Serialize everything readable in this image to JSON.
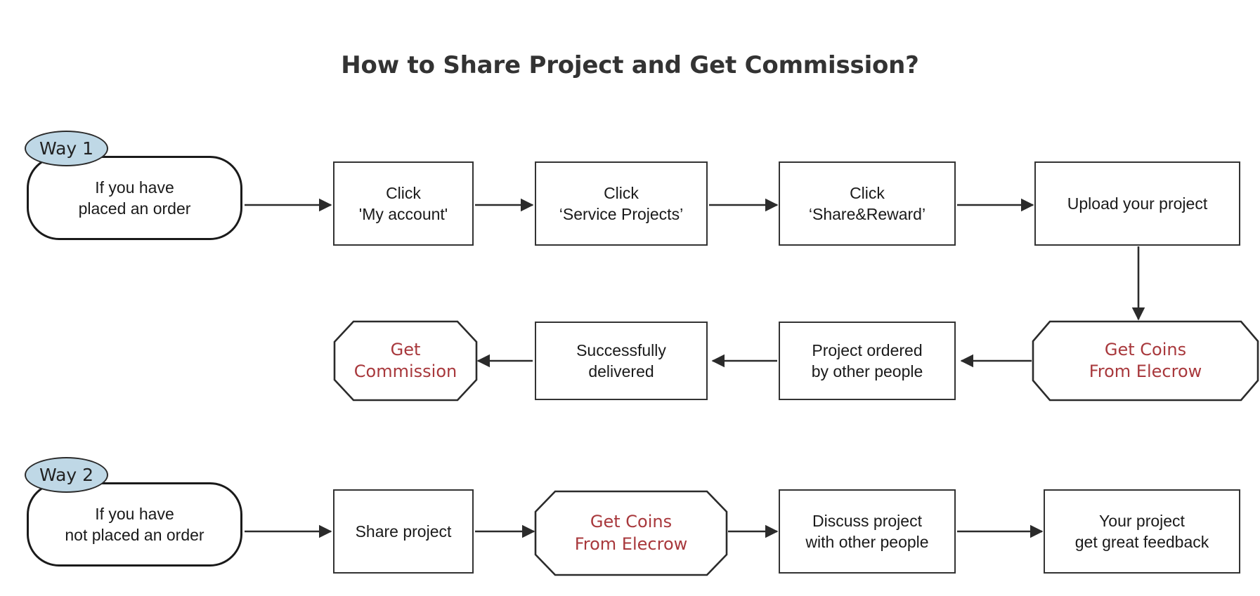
{
  "title": "How to Share Project and Get Commission?",
  "colors": {
    "badge_fill": "#bfd8e6",
    "stroke": "#333333",
    "red_accent": "#a8383c",
    "title_color": "#333333",
    "text_color": "#1a1a1a"
  },
  "way1": {
    "badge": "Way 1",
    "steps": [
      {
        "id": "start",
        "shape": "rounded",
        "text": "If you have\nplaced an order",
        "line1": "If you have",
        "line2": "placed an order"
      },
      {
        "id": "my-account",
        "shape": "rect",
        "line1": "Click",
        "line2": "'My account'"
      },
      {
        "id": "service-projects",
        "shape": "rect",
        "line1": "Click",
        "line2": "‘Service Projects’"
      },
      {
        "id": "share-reward",
        "shape": "rect",
        "line1": "Click",
        "line2": "‘Share&Reward’"
      },
      {
        "id": "upload-project",
        "shape": "rect",
        "line1": "Upload your project",
        "line2": ""
      },
      {
        "id": "get-coins",
        "shape": "octagon",
        "line1": "Get Coins",
        "line2": "From Elecrow",
        "accent": true
      },
      {
        "id": "project-ordered",
        "shape": "rect",
        "line1": "Project ordered",
        "line2": "by other people"
      },
      {
        "id": "successfully-delivered",
        "shape": "rect",
        "line1": "Successfully",
        "line2": "delivered"
      },
      {
        "id": "get-commission",
        "shape": "octagon",
        "line1": "Get",
        "line2": "Commission",
        "accent": true
      }
    ]
  },
  "way2": {
    "badge": "Way 2",
    "steps": [
      {
        "id": "start2",
        "shape": "rounded",
        "line1": "If you have",
        "line2": "not placed an order"
      },
      {
        "id": "share-project",
        "shape": "rect",
        "line1": "Share project",
        "line2": ""
      },
      {
        "id": "get-coins-2",
        "shape": "octagon",
        "line1": "Get Coins",
        "line2": "From Elecrow",
        "accent": true
      },
      {
        "id": "discuss-project",
        "shape": "rect",
        "line1": "Discuss project",
        "line2": "with other people"
      },
      {
        "id": "feedback",
        "shape": "rect",
        "line1": "Your project",
        "line2": "get great feedback"
      }
    ]
  }
}
